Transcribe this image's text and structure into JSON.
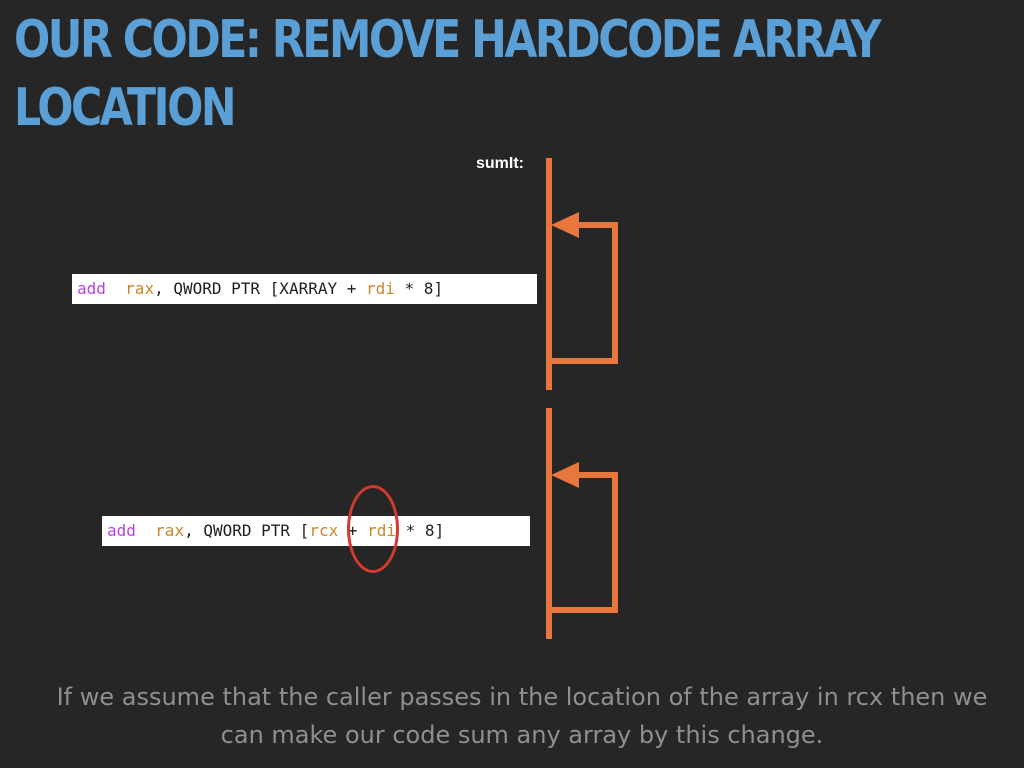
{
  "slide": {
    "title_line1": "OUR CODE: REMOVE HARDCODE ARRAY",
    "title_line2": "LOCATION",
    "label": "sumIt:",
    "code_before": {
      "mnemonic": "add",
      "gap": "  ",
      "dest": "rax",
      "mid": ", QWORD PTR [XARRAY + ",
      "index": "rdi",
      "tail": " * 8]"
    },
    "code_after": {
      "mnemonic": "add",
      "gap": "  ",
      "dest": "rax",
      "mid": ", QWORD PTR [",
      "base": "rcx",
      "plus": " + ",
      "index": "rdi",
      "tail": " * 8]"
    },
    "caption": "If we assume that the caller passes in the location of the array in rcx then we can make our code sum any array by this change.",
    "colors": {
      "background": "#262626",
      "title": "#5aa0d7",
      "arrow": "#e8773d",
      "highlight_circle": "#d33a2e",
      "keyword": "#b543e0",
      "register": "#c8872f"
    }
  }
}
